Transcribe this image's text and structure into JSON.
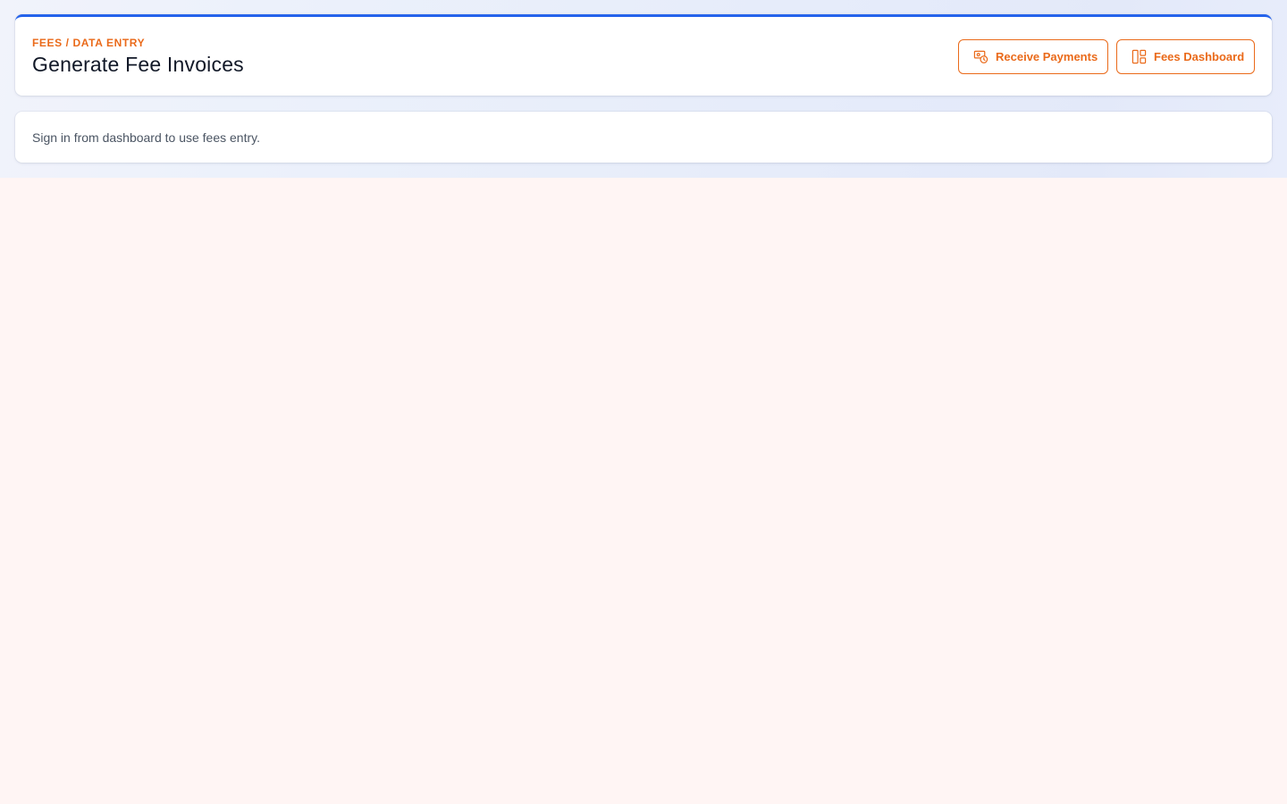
{
  "header": {
    "breadcrumb": "FEES / DATA ENTRY",
    "title": "Generate Fee Invoices",
    "accent_color": "#2563eb",
    "action_color": "#ea6a1a"
  },
  "actions": {
    "receive_payments": {
      "label": "Receive Payments",
      "icon": "money-clock-icon"
    },
    "fees_dashboard": {
      "label": "Fees Dashboard",
      "icon": "dashboard-layout-icon"
    }
  },
  "notice": {
    "text": "Sign in from dashboard to use fees entry."
  }
}
